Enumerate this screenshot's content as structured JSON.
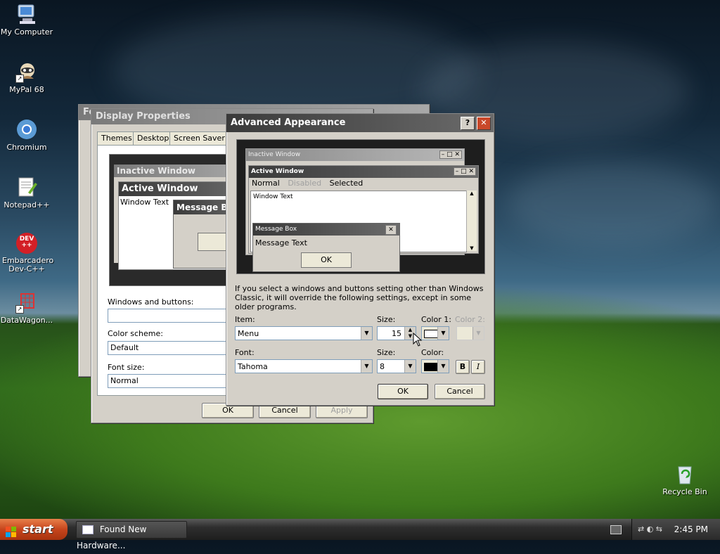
{
  "desktop": {
    "icons": [
      {
        "label": "My Computer"
      },
      {
        "label": "MyPal 68"
      },
      {
        "label": "Chromium"
      },
      {
        "label": "Notepad++"
      },
      {
        "label": "Embarcadero Dev-C++",
        "badge": "DEV ++"
      },
      {
        "label": "DataWagon..."
      },
      {
        "label": "Recycle Bin"
      }
    ]
  },
  "behind_window": {
    "title_fragment": "Fo"
  },
  "display_properties": {
    "title": "Display Properties",
    "tabs": [
      "Themes",
      "Desktop",
      "Screen Saver"
    ],
    "preview": {
      "inactive_title": "Inactive Window",
      "active_title": "Active Window",
      "window_text": "Window Text",
      "message_title": "Message B"
    },
    "windows_and_buttons_label": "Windows and buttons:",
    "windows_and_buttons_value": "",
    "color_scheme_label": "Color scheme:",
    "color_scheme_value": "Default",
    "font_size_label": "Font size:",
    "font_size_value": "Normal",
    "ok": "OK",
    "cancel": "Cancel",
    "apply": "Apply"
  },
  "advanced_appearance": {
    "title": "Advanced Appearance",
    "help": "?",
    "close": "✕",
    "preview": {
      "inactive_title": "Inactive Window",
      "active_title": "Active Window",
      "menu_normal": "Normal",
      "menu_disabled": "Disabled",
      "menu_selected": "Selected",
      "window_text": "Window Text",
      "message_title": "Message Box",
      "message_text": "Message Text",
      "message_ok": "OK"
    },
    "info_text": "If you select a windows and buttons setting other than Windows Classic, it will override the following settings, except in some older programs.",
    "item_label": "Item:",
    "item_value": "Menu",
    "size_label": "Size:",
    "size_value": "15",
    "color1_label": "Color 1:",
    "color1_value": "#ffffff",
    "color2_label": "Color 2:",
    "font_label": "Font:",
    "font_value": "Tahoma",
    "font_size_label": "Size:",
    "font_size_value": "8",
    "font_color_label": "Color:",
    "font_color_value": "#000000",
    "bold": "B",
    "italic": "I",
    "ok": "OK",
    "cancel": "Cancel"
  },
  "taskbar": {
    "start_label": "start",
    "task_item": "Found New Hardware...",
    "clock": "2:45 PM"
  }
}
